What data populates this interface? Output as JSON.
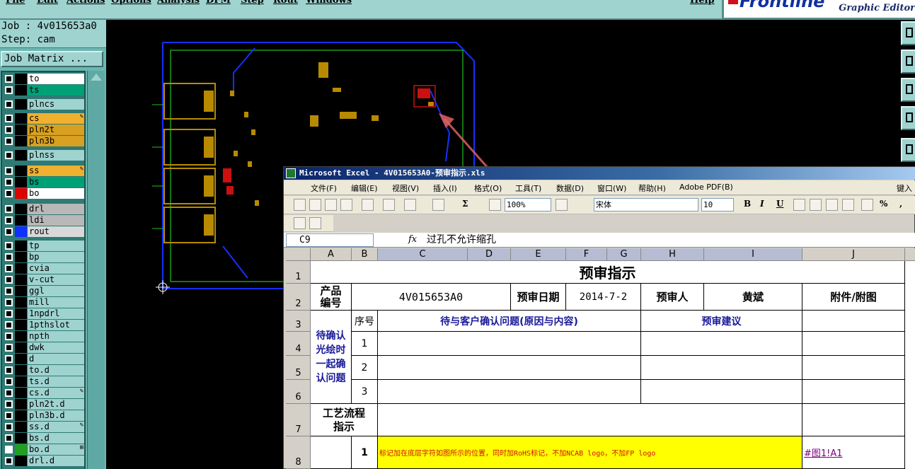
{
  "app": {
    "menu": [
      "File",
      "Edit",
      "Actions",
      "Options",
      "Analysis",
      "DFM",
      "Step",
      "Rout",
      "Windows"
    ],
    "help": "Help",
    "logo_brand": "Frontline",
    "logo_sub": "Graphic Editor"
  },
  "job": {
    "label": "Job : 4v015653a0",
    "step": "Step: cam",
    "matrix_button": "Job Matrix ..."
  },
  "layers": [
    {
      "name": "to",
      "color": "#ffffff",
      "swatch": "#000000",
      "checked": false,
      "mark": ""
    },
    {
      "name": "ts",
      "color": "#00a077",
      "swatch": "#000000",
      "checked": false,
      "mark": ""
    },
    {
      "name": "plncs",
      "color": "#9ed3d0",
      "swatch": "#000000",
      "checked": false,
      "mark": ""
    },
    {
      "name": "cs",
      "color": "#f0b030",
      "swatch": "#000000",
      "checked": false,
      "mark": "✎"
    },
    {
      "name": "pln2t",
      "color": "#d8a020",
      "swatch": "#000000",
      "checked": false,
      "mark": ""
    },
    {
      "name": "pln3b",
      "color": "#d8a020",
      "swatch": "#000000",
      "checked": false,
      "mark": ""
    },
    {
      "name": "plnss",
      "color": "#9ed3d0",
      "swatch": "#000000",
      "checked": false,
      "mark": ""
    },
    {
      "name": "ss",
      "color": "#f0b030",
      "swatch": "#000000",
      "checked": false,
      "mark": "✎"
    },
    {
      "name": "bs",
      "color": "#00a077",
      "swatch": "#000000",
      "checked": false,
      "mark": ""
    },
    {
      "name": "bo",
      "color": "#ffffff",
      "swatch": "#e00000",
      "checked": false,
      "mark": ""
    },
    {
      "name": "drl",
      "color": "#b8b8b8",
      "swatch": "#000000",
      "checked": false,
      "mark": ""
    },
    {
      "name": "ldi",
      "color": "#b8b8b8",
      "swatch": "#000000",
      "checked": false,
      "mark": ""
    },
    {
      "name": "rout",
      "color": "#d8d8d8",
      "swatch": "#1030ff",
      "checked": false,
      "mark": ""
    },
    {
      "name": "tp",
      "color": "#9ed3d0",
      "swatch": "#000000",
      "checked": false,
      "mark": ""
    },
    {
      "name": "bp",
      "color": "#9ed3d0",
      "swatch": "#000000",
      "checked": false,
      "mark": ""
    },
    {
      "name": "cvia",
      "color": "#9ed3d0",
      "swatch": "#000000",
      "checked": false,
      "mark": ""
    },
    {
      "name": "v-cut",
      "color": "#9ed3d0",
      "swatch": "#000000",
      "checked": false,
      "mark": ""
    },
    {
      "name": "ggl",
      "color": "#9ed3d0",
      "swatch": "#000000",
      "checked": false,
      "mark": ""
    },
    {
      "name": "mill",
      "color": "#9ed3d0",
      "swatch": "#000000",
      "checked": false,
      "mark": ""
    },
    {
      "name": "1npdrl",
      "color": "#9ed3d0",
      "swatch": "#000000",
      "checked": false,
      "mark": ""
    },
    {
      "name": "1pthslot",
      "color": "#9ed3d0",
      "swatch": "#000000",
      "checked": false,
      "mark": ""
    },
    {
      "name": "npth",
      "color": "#9ed3d0",
      "swatch": "#000000",
      "checked": false,
      "mark": ""
    },
    {
      "name": "dwk",
      "color": "#9ed3d0",
      "swatch": "#000000",
      "checked": false,
      "mark": ""
    },
    {
      "name": "d",
      "color": "#9ed3d0",
      "swatch": "#000000",
      "checked": false,
      "mark": ""
    },
    {
      "name": "to.d",
      "color": "#9ed3d0",
      "swatch": "#000000",
      "checked": false,
      "mark": ""
    },
    {
      "name": "ts.d",
      "color": "#9ed3d0",
      "swatch": "#000000",
      "checked": false,
      "mark": ""
    },
    {
      "name": "cs.d",
      "color": "#9ed3d0",
      "swatch": "#000000",
      "checked": false,
      "mark": "✎"
    },
    {
      "name": "pln2t.d",
      "color": "#9ed3d0",
      "swatch": "#000000",
      "checked": false,
      "mark": ""
    },
    {
      "name": "pln3b.d",
      "color": "#9ed3d0",
      "swatch": "#000000",
      "checked": false,
      "mark": ""
    },
    {
      "name": "ss.d",
      "color": "#9ed3d0",
      "swatch": "#000000",
      "checked": false,
      "mark": "✎"
    },
    {
      "name": "bs.d",
      "color": "#9ed3d0",
      "swatch": "#000000",
      "checked": false,
      "mark": ""
    },
    {
      "name": "bo.d",
      "color": "#9ed3d0",
      "swatch": "#20a020",
      "checked": true,
      "mark": "⊞"
    },
    {
      "name": "drl.d",
      "color": "#9ed3d0",
      "swatch": "#000000",
      "checked": false,
      "mark": ""
    }
  ],
  "excel": {
    "title": "Microsoft Excel - 4V015653A0-预审指示.xls",
    "menu": [
      "文件(F)",
      "编辑(E)",
      "视图(V)",
      "插入(I)",
      "格式(O)",
      "工具(T)",
      "数据(D)",
      "窗口(W)",
      "帮助(H)",
      "Adobe PDF(B)"
    ],
    "menu_right": "键入",
    "zoom": "100%",
    "font": "宋体",
    "size": "10",
    "bold": "B",
    "italic": "I",
    "underline": "U",
    "sigma": "Σ",
    "percent": "%",
    "comma": ",",
    "name_box": "C9",
    "fx": "fx",
    "formula": "过孔不允许缩孔",
    "columns": [
      "A",
      "B",
      "C",
      "D",
      "E",
      "F",
      "G",
      "H",
      "I",
      "J"
    ],
    "rows": [
      "1",
      "2",
      "3",
      "4",
      "5",
      "6",
      "7",
      "8"
    ],
    "sheet": {
      "title": "预审指示",
      "product_no_label": "产品\n编号",
      "product_no": "4V015653A0",
      "review_date_label": "预审日期",
      "review_date": "2014-7-2",
      "reviewer_label": "预审人",
      "reviewer": "黄斌",
      "attachment_label": "附件/附图",
      "confirm_label": "待确认\n光绘时\n一起确\n认问题",
      "seq_label": "序号",
      "issue_label": "待与客户确认问题(原因与内容)",
      "suggest_label": "预审建议",
      "seq": [
        "1",
        "2",
        "3"
      ],
      "process_label": "工艺流程\n指示",
      "row8_no": "1",
      "row8_text": "标记加在底层字符如图所示的位置，同时加RoHS标记，不加NCAB logo，不加FP logo",
      "row8_link": "#图1!A1"
    }
  }
}
